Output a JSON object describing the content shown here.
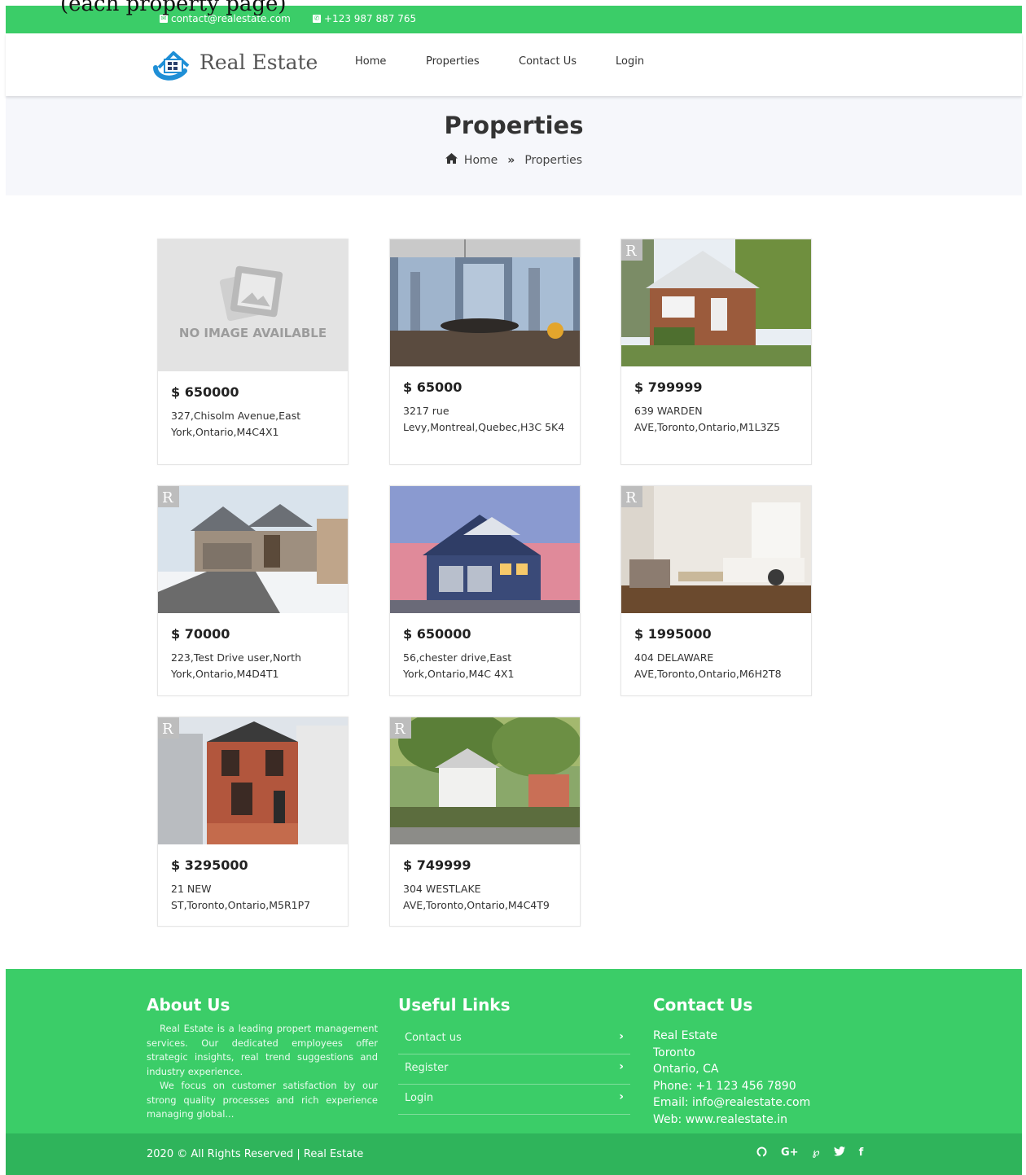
{
  "caption": "(each property page)",
  "topbar": {
    "email": "contact@realestate.com",
    "phone": "+123 987 887 765"
  },
  "brand": {
    "name": "Real Estate"
  },
  "nav": {
    "items": [
      "Home",
      "Properties",
      "Contact Us",
      "Login"
    ]
  },
  "hero": {
    "title": "Properties",
    "breadcrumb": {
      "home": "Home",
      "current": "Properties"
    }
  },
  "listings": [
    {
      "price": "$ 650000",
      "address": "327,Chisolm Avenue,East York,Ontario,M4C4X1",
      "image": "no-image-placeholder",
      "placeholder_text": "NO IMAGE AVAILABLE"
    },
    {
      "price": "$ 65000",
      "address": "3217 rue Levy,Montreal,Quebec,H3C 5K4",
      "image": "dining-room-photo"
    },
    {
      "price": "$ 799999",
      "address": "639 WARDEN AVE,Toronto,Ontario,M1L3Z5",
      "image": "brick-bungalow-photo"
    },
    {
      "price": "$ 70000",
      "address": "223,Test Drive user,North York,Ontario,M4D4T1",
      "image": "snowy-house-photo"
    },
    {
      "price": "$ 650000",
      "address": "56,chester drive,East York,Ontario,M4C 4X1",
      "image": "house-at-dusk-photo"
    },
    {
      "price": "$ 1995000",
      "address": "404 DELAWARE AVE,Toronto,Ontario,M6H2T8",
      "image": "living-room-photo"
    },
    {
      "price": "$ 3295000",
      "address": "21 NEW ST,Toronto,Ontario,M5R1P7",
      "image": "red-brick-house-photo"
    },
    {
      "price": "$ 749999",
      "address": "304 WESTLAKE AVE,Toronto,Ontario,M4C4T9",
      "image": "tree-lined-house-photo"
    }
  ],
  "footer": {
    "about": {
      "title": "About Us",
      "p1": "Real Estate is a leading propert management services. Our dedicated employees offer strategic insights, real trend suggestions and industry experience.",
      "p2": "We focus on customer satisfaction by our strong quality processes and rich experience managing global..."
    },
    "links": {
      "title": "Useful Links",
      "items": [
        "Contact us",
        "Register",
        "Login"
      ]
    },
    "contact": {
      "title": "Contact Us",
      "lines": [
        "Real Estate",
        "Toronto",
        "Ontario, CA",
        "Phone: +1 123 456 7890",
        "Email: info@realestate.com",
        "Web: www.realestate.in"
      ]
    },
    "copyright": "2020 © All Rights Reserved | Real Estate",
    "social_icons": [
      "github-icon",
      "google-plus-icon",
      "pinterest-icon",
      "twitter-icon",
      "facebook-icon"
    ]
  },
  "colors": {
    "accent": "#3bcd68",
    "accent_dark": "#2fb45b",
    "hero_bg": "#f6f7fb",
    "logo_blue": "#1f8fd6"
  }
}
